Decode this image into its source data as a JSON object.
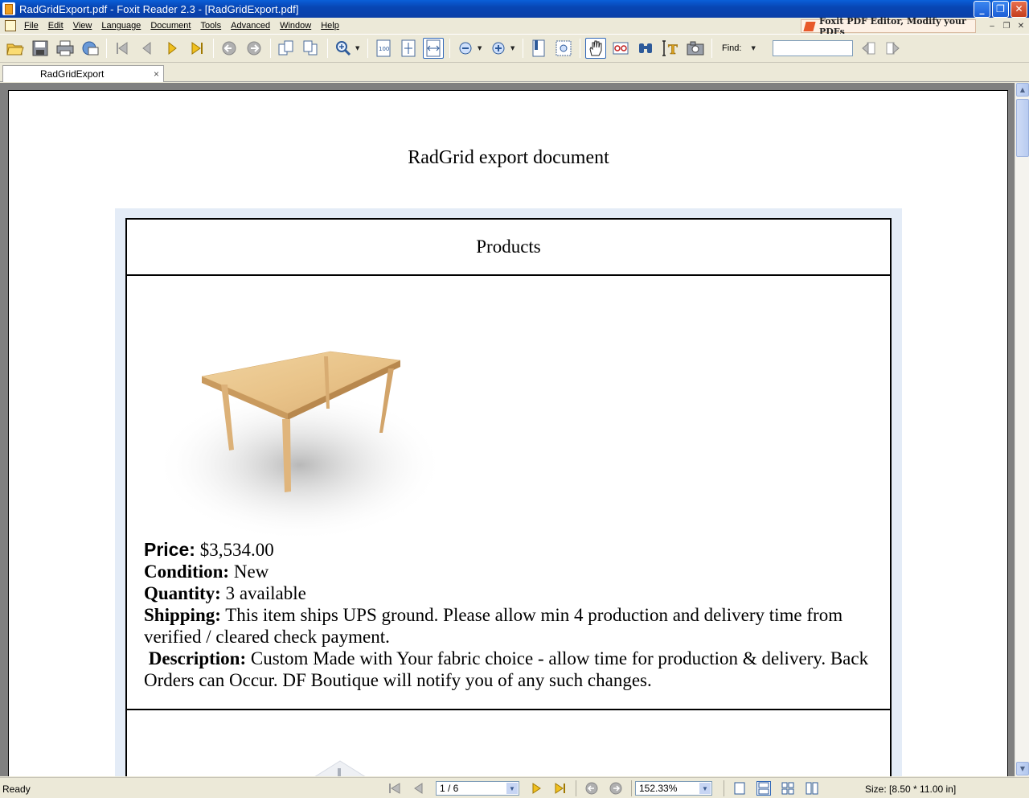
{
  "window": {
    "title": "RadGridExport.pdf - Foxit Reader 2.3 - [RadGridExport.pdf]",
    "minimize_label": "_",
    "maximize_label": "❐",
    "close_label": "✕"
  },
  "menubar": {
    "items": [
      "File",
      "Edit",
      "View",
      "Language",
      "Document",
      "Tools",
      "Advanced",
      "Window",
      "Help"
    ],
    "ad_banner": "Foxit PDF Editor, Modify your PDFs",
    "mdi_minimize": "–",
    "mdi_restore": "❐",
    "mdi_close": "✕"
  },
  "toolbar": {
    "find_label": "Find:",
    "find_value": "",
    "icons": [
      "open-icon",
      "save-icon",
      "print-icon",
      "email-icon",
      "first-page-icon",
      "previous-page-icon",
      "next-page-icon",
      "last-page-icon",
      "back-icon",
      "forward-icon",
      "rotate-left-icon",
      "rotate-right-icon",
      "zoom-in-tool-icon",
      "actual-size-icon",
      "fit-page-icon",
      "fit-width-icon",
      "zoom-out-icon",
      "zoom-in-icon",
      "bookmark-icon",
      "snapshot-icon",
      "hand-tool-icon",
      "reading-icon",
      "find-icon",
      "select-text-icon",
      "camera-icon"
    ]
  },
  "tabs": [
    {
      "label": "RadGridExport",
      "close_label": "×"
    }
  ],
  "document": {
    "title": "RadGrid export document",
    "grid_header": "Products",
    "product": {
      "price_label": "Price:",
      "price_value": "$3,534.00",
      "condition_label": "Condition:",
      "condition_value": "New",
      "quantity_label": "Quantity:",
      "quantity_value": "3 available",
      "shipping_label": "Shipping:",
      "shipping_value": "This item ships UPS ground. Please allow min 4 production and delivery time from verified / cleared check payment.",
      "description_label": "Description:",
      "description_value": "Custom Made with Your fabric choice - allow time for production & delivery. Back Orders can Occur. DF Boutique will notify you of any such changes."
    }
  },
  "statusbar": {
    "status": "Ready",
    "page_indicator": "1 / 6",
    "zoom": "152.33%",
    "size": "Size: [8.50 * 11.00 in]"
  },
  "colors": {
    "titlebar": "#0a4fc4",
    "chrome": "#ece9d8",
    "viewer_background": "#808080",
    "grid_frame": "#e4ecf7"
  }
}
